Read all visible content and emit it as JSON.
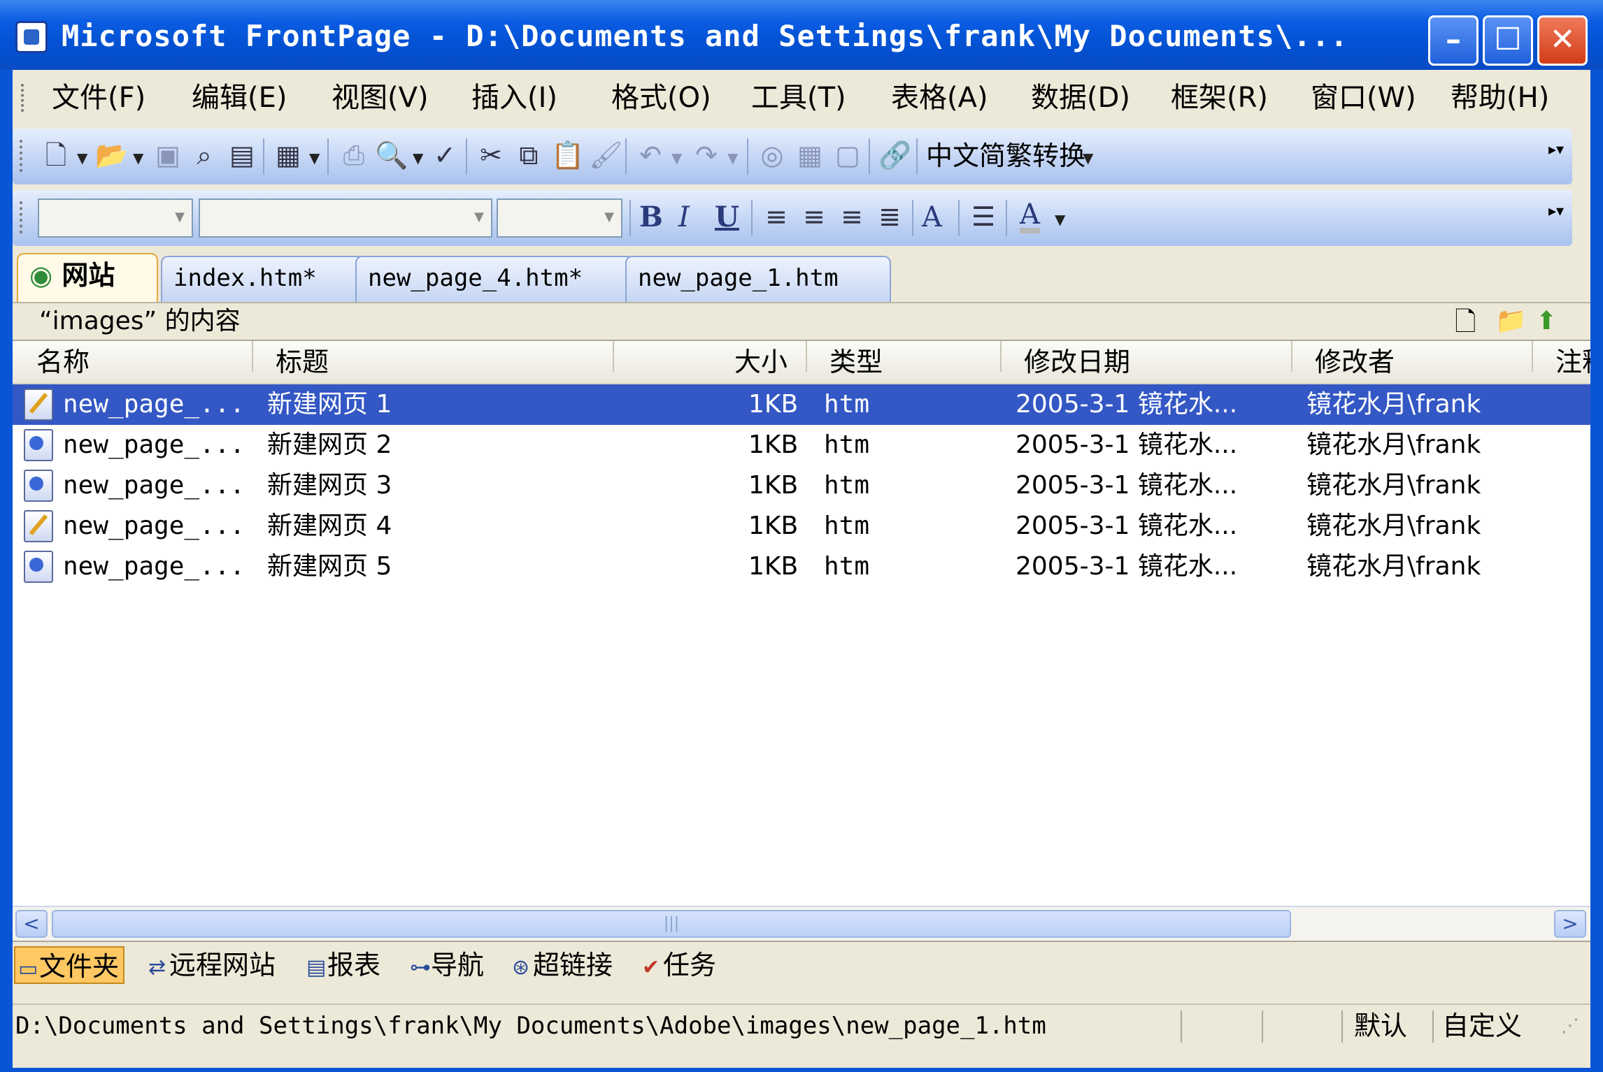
{
  "window": {
    "title": "Microsoft FrontPage - D:\\Documents and Settings\\frank\\My Documents\\...",
    "minimize_glyph": "–",
    "maximize_glyph": "☐",
    "close_glyph": "✕"
  },
  "menu": [
    "文件(F)",
    "编辑(E)",
    "视图(V)",
    "插入(I)",
    "格式(O)",
    "工具(T)",
    "表格(A)",
    "数据(D)",
    "框架(R)",
    "窗口(W)",
    "帮助(H)"
  ],
  "toolbar": {
    "convert_label": "中文简繁转换"
  },
  "format_toolbar": {
    "bold": "B",
    "italic": "I",
    "underline": "U",
    "grow_font": "A",
    "font_color": "A"
  },
  "tabs": [
    "网站",
    "index.htm*",
    "new_page_4.htm*",
    "new_page_1.htm"
  ],
  "folder": {
    "title": "“images” 的内容"
  },
  "columns": [
    "名称",
    "标题",
    "大小",
    "类型",
    "修改日期",
    "修改者",
    "注释"
  ],
  "files": [
    {
      "name": "new_page_...",
      "title": "新建网页 1",
      "size": "1KB",
      "type": "htm",
      "modified": "2005-3-1 镜花水...",
      "modified_by": "镜花水月\\frank",
      "icon": "edit-page-icon",
      "selected": true
    },
    {
      "name": "new_page_...",
      "title": "新建网页 2",
      "size": "1KB",
      "type": "htm",
      "modified": "2005-3-1 镜花水...",
      "modified_by": "镜花水月\\frank",
      "icon": "web-page-icon",
      "selected": false
    },
    {
      "name": "new_page_...",
      "title": "新建网页 3",
      "size": "1KB",
      "type": "htm",
      "modified": "2005-3-1 镜花水...",
      "modified_by": "镜花水月\\frank",
      "icon": "web-page-icon",
      "selected": false
    },
    {
      "name": "new_page_...",
      "title": "新建网页 4",
      "size": "1KB",
      "type": "htm",
      "modified": "2005-3-1 镜花水...",
      "modified_by": "镜花水月\\frank",
      "icon": "edit-page-icon",
      "selected": false
    },
    {
      "name": "new_page_...",
      "title": "新建网页 5",
      "size": "1KB",
      "type": "htm",
      "modified": "2005-3-1 镜花水...",
      "modified_by": "镜花水月\\frank",
      "icon": "web-page-icon",
      "selected": false
    }
  ],
  "scrollbar": {
    "left": "<",
    "right": ">",
    "thumb_grip": "|||"
  },
  "views": [
    "文件夹",
    "远程网站",
    "报表",
    "导航",
    "超链接",
    "任务"
  ],
  "status": {
    "path": "D:\\Documents and Settings\\frank\\My Documents\\Adobe\\images\\new_page_1.htm",
    "default_label": "默认",
    "custom_label": "自定义"
  },
  "colors": {
    "selection": "#3357c4",
    "titlebar": "#0a55d6",
    "active_view": "#ffc862"
  }
}
